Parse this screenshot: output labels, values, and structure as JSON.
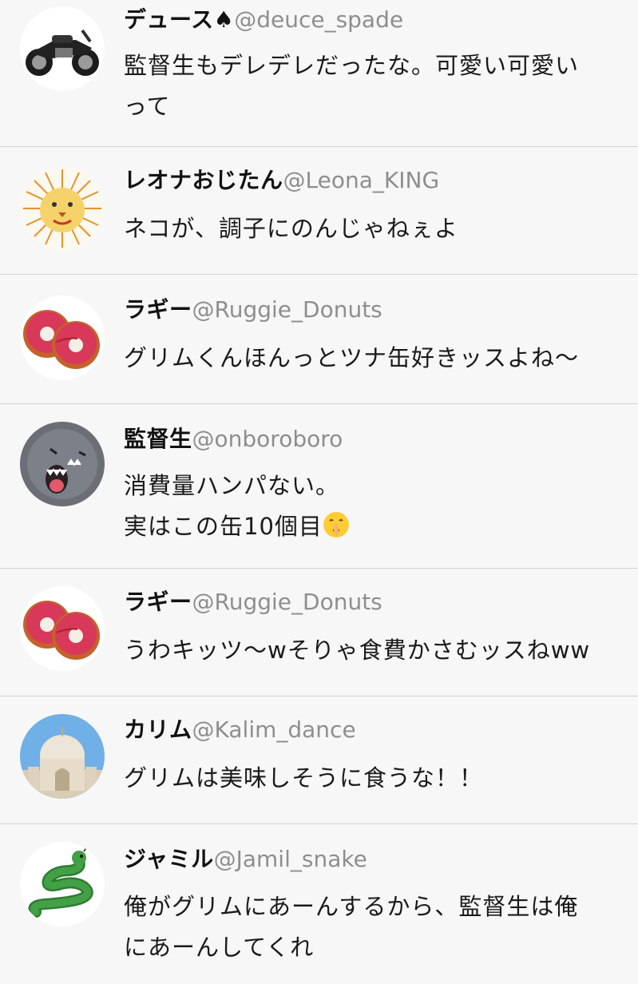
{
  "posts": [
    {
      "name": "デュース♠",
      "handle": "@deuce_spade",
      "avatar": "motorcycle-avatar",
      "lines": [
        "監督生もデレデレだったな。可愛い可愛い",
        "って"
      ]
    },
    {
      "name": "レオナおじたん",
      "handle": "@Leona_KING",
      "avatar": "lion-drawing-avatar",
      "lines": [
        "ネコが、調子にのんじゃねぇよ"
      ]
    },
    {
      "name": "ラギー",
      "handle": "@Ruggie_Donuts",
      "avatar": "donuts-avatar",
      "lines": [
        "グリムくんほんっとツナ缶好きッスよね〜"
      ]
    },
    {
      "name": "監督生",
      "handle": "@onboroboro",
      "avatar": "ghost-avatar",
      "lines": [
        "消費量ハンパない。",
        "実はこの缶10個目"
      ],
      "emoji": "shushing-face-emoji"
    },
    {
      "name": "ラギー",
      "handle": "@Ruggie_Donuts",
      "avatar": "donuts-avatar",
      "lines": [
        "うわキッツ〜wそりゃ食費かさむッスねww"
      ]
    },
    {
      "name": "カリム",
      "handle": "@Kalim_dance",
      "avatar": "palace-avatar",
      "lines": [
        "グリムは美味しそうに食うな！！"
      ]
    },
    {
      "name": "ジャミル",
      "handle": "@Jamil_snake",
      "avatar": "snake-avatar",
      "lines": [
        "俺がグリムにあーんするから、監督生は俺",
        "にあーんしてくれ"
      ]
    }
  ]
}
